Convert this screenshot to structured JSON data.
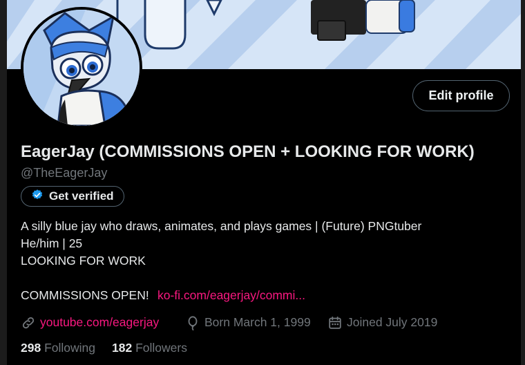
{
  "profile": {
    "display_name": "EagerJay (COMMISSIONS OPEN + LOOKING FOR WORK)",
    "handle": "@TheEagerJay",
    "edit_label": "Edit profile",
    "verify_label": "Get verified",
    "bio_lines": "A silly blue jay who draws, animates, and plays games | (Future) PNGtuber\nHe/him | 25\nLOOKING FOR WORK",
    "bio_commission": "COMMISSIONS OPEN!",
    "bio_link": "ko-fi.com/eagerjay/commi...",
    "website": "youtube.com/eagerjay",
    "birthday": "Born March 1, 1999",
    "joined": "Joined July 2019",
    "following_count": "298",
    "following_label": "Following",
    "followers_count": "182",
    "followers_label": "Followers"
  },
  "colors": {
    "background": "#000000",
    "text": "#e7e9ea",
    "muted": "#71767b",
    "link": "#f91880",
    "verified": "#1d9bf0"
  }
}
